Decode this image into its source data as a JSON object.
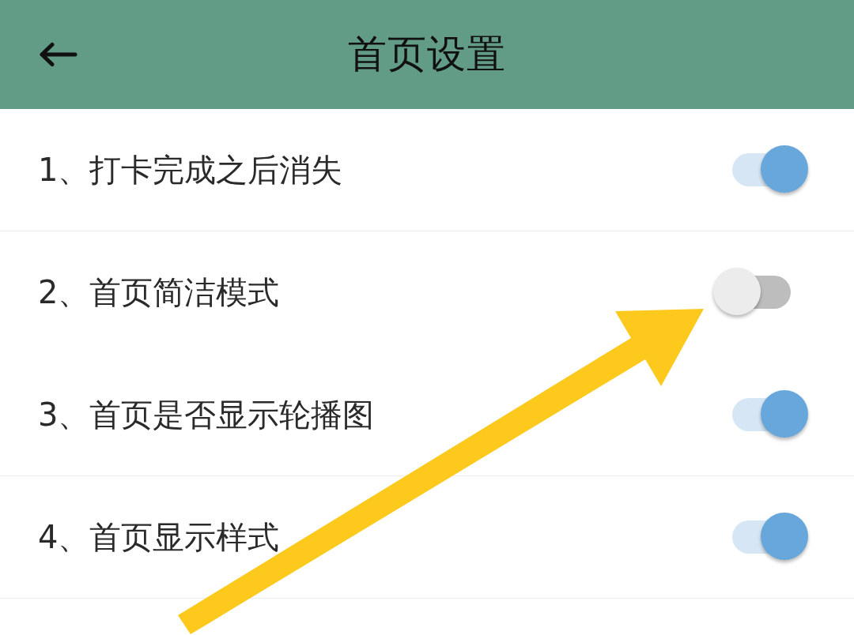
{
  "header": {
    "title": "首页设置"
  },
  "settings": [
    {
      "label": "1、打卡完成之后消失",
      "kind": "toggle",
      "on": true,
      "divider": true
    },
    {
      "label": "2、首页简洁模式",
      "kind": "toggle",
      "on": false,
      "divider": false
    },
    {
      "label": "3、首页是否显示轮播图",
      "kind": "toggle",
      "on": true,
      "divider": true
    },
    {
      "label": "4、首页显示样式",
      "kind": "toggle",
      "on": true,
      "divider": true
    }
  ]
}
